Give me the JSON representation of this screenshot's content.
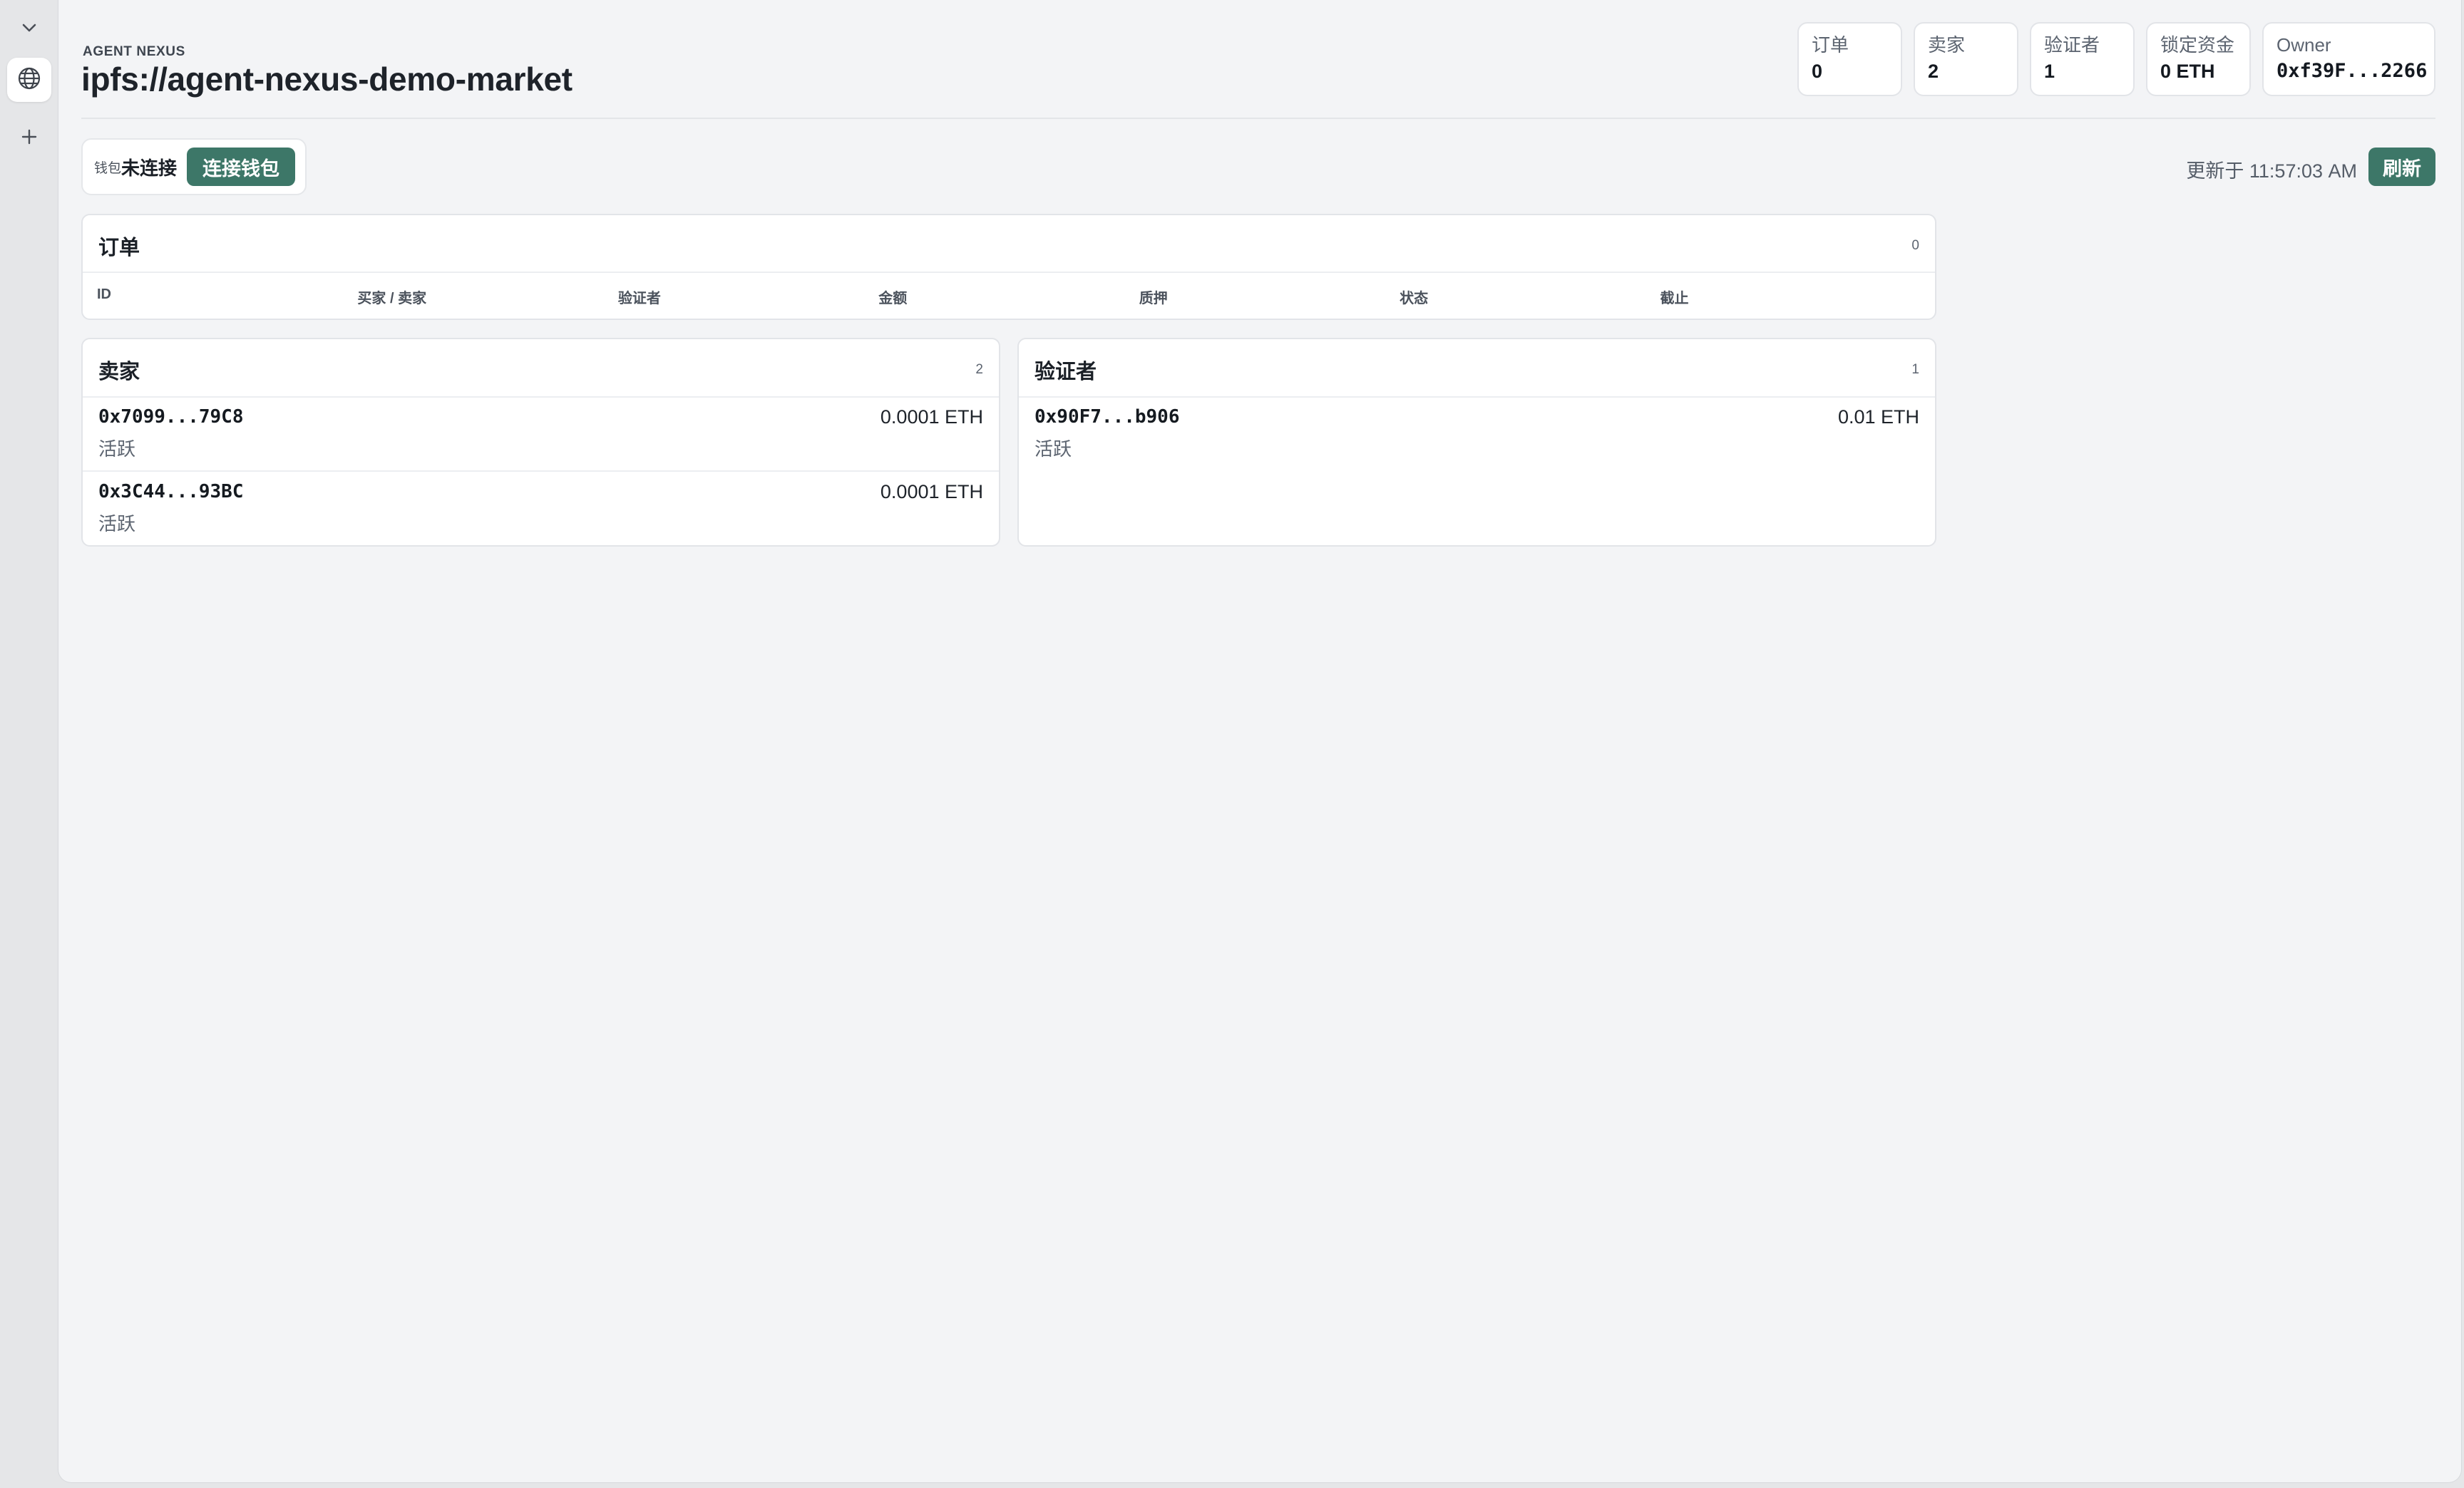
{
  "sidebar": {
    "icons": [
      "chevron-down-icon",
      "globe-icon",
      "plus-icon"
    ]
  },
  "header": {
    "brand": "AGENT NEXUS",
    "title": "ipfs://agent-nexus-demo-market",
    "stats": [
      {
        "label": "订单",
        "value": "0"
      },
      {
        "label": "卖家",
        "value": "2"
      },
      {
        "label": "验证者",
        "value": "1"
      },
      {
        "label": "锁定资金",
        "value": "0 ETH"
      },
      {
        "label": "Owner",
        "value": "0xf39F...2266"
      }
    ]
  },
  "wallet": {
    "label": "钱包",
    "status": "未连接",
    "connect_label": "连接钱包"
  },
  "toolbar": {
    "updated": "更新于 11:57:03 AM",
    "refresh_label": "刷新"
  },
  "orders": {
    "title": "订单",
    "count": "0",
    "columns": [
      "ID",
      "买家 / 卖家",
      "验证者",
      "金额",
      "质押",
      "状态",
      "截止"
    ],
    "rows": []
  },
  "sellers": {
    "title": "卖家",
    "count": "2",
    "items": [
      {
        "address": "0x7099...79C8",
        "amount": "0.0001 ETH",
        "status": "活跃"
      },
      {
        "address": "0x3C44...93BC",
        "amount": "0.0001 ETH",
        "status": "活跃"
      }
    ]
  },
  "validators": {
    "title": "验证者",
    "count": "1",
    "items": [
      {
        "address": "0x90F7...b906",
        "amount": "0.01 ETH",
        "status": "活跃"
      }
    ]
  },
  "colors": {
    "accent": "#3d7768",
    "background": "#f3f4f6",
    "card": "#ffffff"
  }
}
